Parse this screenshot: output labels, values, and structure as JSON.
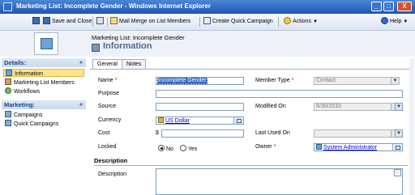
{
  "window": {
    "title": "Marketing List: Incomplete Gender - Windows Internet Explorer",
    "controls": {
      "minimize": "_",
      "maximize": "□",
      "close": "X"
    }
  },
  "toolbar": {
    "save": "",
    "save_and_close": "Save and Close",
    "mail_merge": "Mail Merge on List Members",
    "create_campaign": "Create Quick Campaign",
    "actions": "Actions",
    "help": "Help"
  },
  "header": {
    "record_title": "Marketing List: Incomplete Gender",
    "form_title": "Information"
  },
  "nav": {
    "details_header": "Details:",
    "details_items": [
      "Information",
      "Marketing List Members",
      "Workflows"
    ],
    "marketing_header": "Marketing:",
    "marketing_items": [
      "Campaigns",
      "Quick Campaigns"
    ]
  },
  "tabs": [
    "General",
    "Notes"
  ],
  "form": {
    "name_label": "Name",
    "name_value": "Incomplete Gender",
    "purpose_label": "Purpose",
    "source_label": "Source",
    "currency_label": "Currency",
    "currency_value": "US Dollar",
    "cost_label": "Cost",
    "cost_prefix": "$",
    "locked_label": "Locked",
    "locked_no": "No",
    "locked_yes": "Yes",
    "member_type_label": "Member Type",
    "member_type_value": "Contact",
    "modified_on_label": "Modified On",
    "modified_on_value": "6/30/2010",
    "last_used_label": "Last Used On",
    "owner_label": "Owner",
    "owner_value": "System Administrator",
    "required_marker": "*",
    "description_section": "Description",
    "description_label": "Description"
  },
  "colors": {
    "titlebar": "#1f55b3",
    "form_title": "#4d6a8f",
    "nav_header": "#15428b",
    "selected_nav": "#ffe38a",
    "required": "#cc0000"
  }
}
